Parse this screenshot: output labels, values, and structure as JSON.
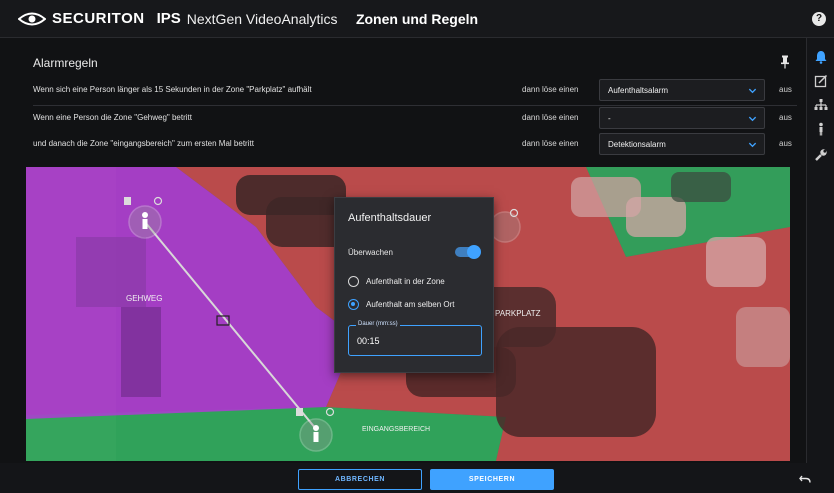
{
  "header": {
    "brand": "SECURITON",
    "brand_sub": "IPS",
    "product": "NextGen VideoAnalytics",
    "page_title": "Zonen und Regeln",
    "help_icon": "?"
  },
  "sidebar": {
    "icons": [
      "bell-icon",
      "edit-icon",
      "network-icon",
      "person-icon",
      "wrench-icon"
    ]
  },
  "rules": {
    "title": "Alarmregeln",
    "rows": [
      {
        "text": "Wenn sich eine Person länger als 15 Sekunden in der Zone \"Parkplatz\" aufhält",
        "then": "dann löse einen",
        "value": "Aufenthaltsalarm",
        "off": "aus"
      },
      {
        "text": "Wenn eine Person die Zone \"Gehweg\" betritt",
        "then": "dann löse einen",
        "value": "-",
        "off": "aus"
      },
      {
        "text": "und danach die Zone \"eingangsbereich\" zum ersten Mal betritt",
        "then": "dann löse einen",
        "value": "Detektionsalarm",
        "off": "aus"
      }
    ]
  },
  "camera": {
    "zones": {
      "gehweg": "GEHWEG",
      "parkplatz": "PARKPLATZ",
      "eingang": "EINGANGSBEREICH"
    },
    "colors": {
      "gehweg": "#b23ad6",
      "parkplatz": "#e04545",
      "eingang": "#27b45a"
    }
  },
  "dialog": {
    "title": "Aufenthaltsdauer",
    "monitor_label": "Überwachen",
    "monitor_on": true,
    "option_zone": "Aufenthalt in der Zone",
    "option_place": "Aufenthalt am selben Ort",
    "selected_option": "option_place",
    "duration_label": "Dauer (mm:ss)",
    "duration_value": "00:15"
  },
  "footer": {
    "cancel_label": "ABBRECHEN",
    "save_label": "SPEICHERN"
  },
  "accent_color": "#3fa2ff"
}
